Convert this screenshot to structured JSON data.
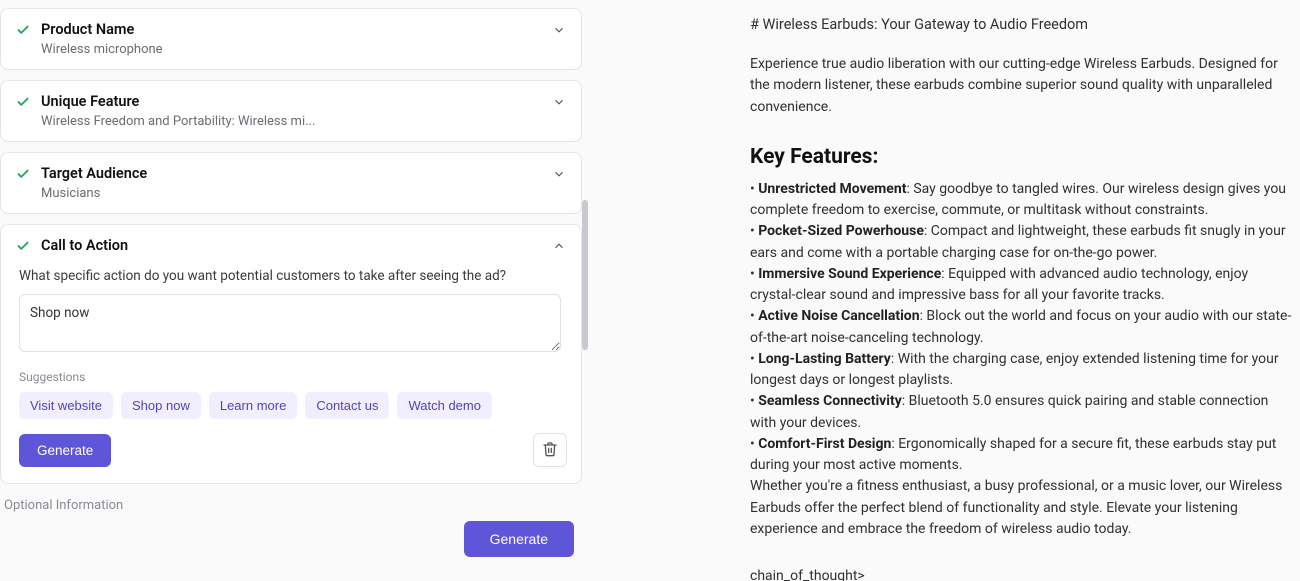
{
  "sections": {
    "product_name": {
      "title": "Product Name",
      "value": "Wireless microphone"
    },
    "unique_feature": {
      "title": "Unique Feature",
      "value": "Wireless Freedom and Portability: Wireless mi..."
    },
    "target_audience": {
      "title": "Target Audience",
      "value": "Musicians"
    },
    "call_to_action": {
      "title": "Call to Action",
      "prompt": "What specific action do you want potential customers to take after seeing the ad?",
      "textarea_value": "Shop now",
      "suggestions_label": "Suggestions",
      "suggestions": [
        "Visit website",
        "Shop now",
        "Learn more",
        "Contact us",
        "Watch demo"
      ],
      "generate_label": "Generate"
    }
  },
  "optional_label": "Optional Information",
  "footer_generate_label": "Generate",
  "output": {
    "heading_line": "# Wireless Earbuds: Your Gateway to Audio Freedom",
    "intro": "Experience true audio liberation with our cutting-edge Wireless Earbuds. Designed for the modern listener, these earbuds combine superior sound quality with unparalleled convenience.",
    "key_features_header": "Key Features:",
    "bullets": [
      {
        "title": "Unrestricted Movement",
        "body": ": Say goodbye to tangled wires. Our wireless design gives you complete freedom to exercise, commute, or multitask without constraints."
      },
      {
        "title": "Pocket-Sized Powerhouse",
        "body": ": Compact and lightweight, these earbuds fit snugly in your ears and come with a portable charging case for on-the-go power."
      },
      {
        "title": "Immersive Sound Experience",
        "body": ": Equipped with advanced audio technology, enjoy crystal-clear sound and impressive bass for all your favorite tracks."
      },
      {
        "title": "Active Noise Cancellation",
        "body": ": Block out the world and focus on your audio with our state-of-the-art noise-canceling technology."
      },
      {
        "title": "Long-Lasting Battery",
        "body": ": With the charging case, enjoy extended listening time for your longest days or longest playlists."
      },
      {
        "title": "Seamless Connectivity",
        "body": ": Bluetooth 5.0 ensures quick pairing and stable connection with your devices."
      },
      {
        "title": "Comfort-First Design",
        "body": ": Ergonomically shaped for a secure fit, these earbuds stay put during your most active moments."
      }
    ],
    "closing": "Whether you're a fitness enthusiast, a busy professional, or a music lover, our Wireless Earbuds offer the perfect blend of functionality and style. Elevate your listening experience and embrace the freedom of wireless audio today.",
    "chain_tag": "chain_of_thought>"
  }
}
